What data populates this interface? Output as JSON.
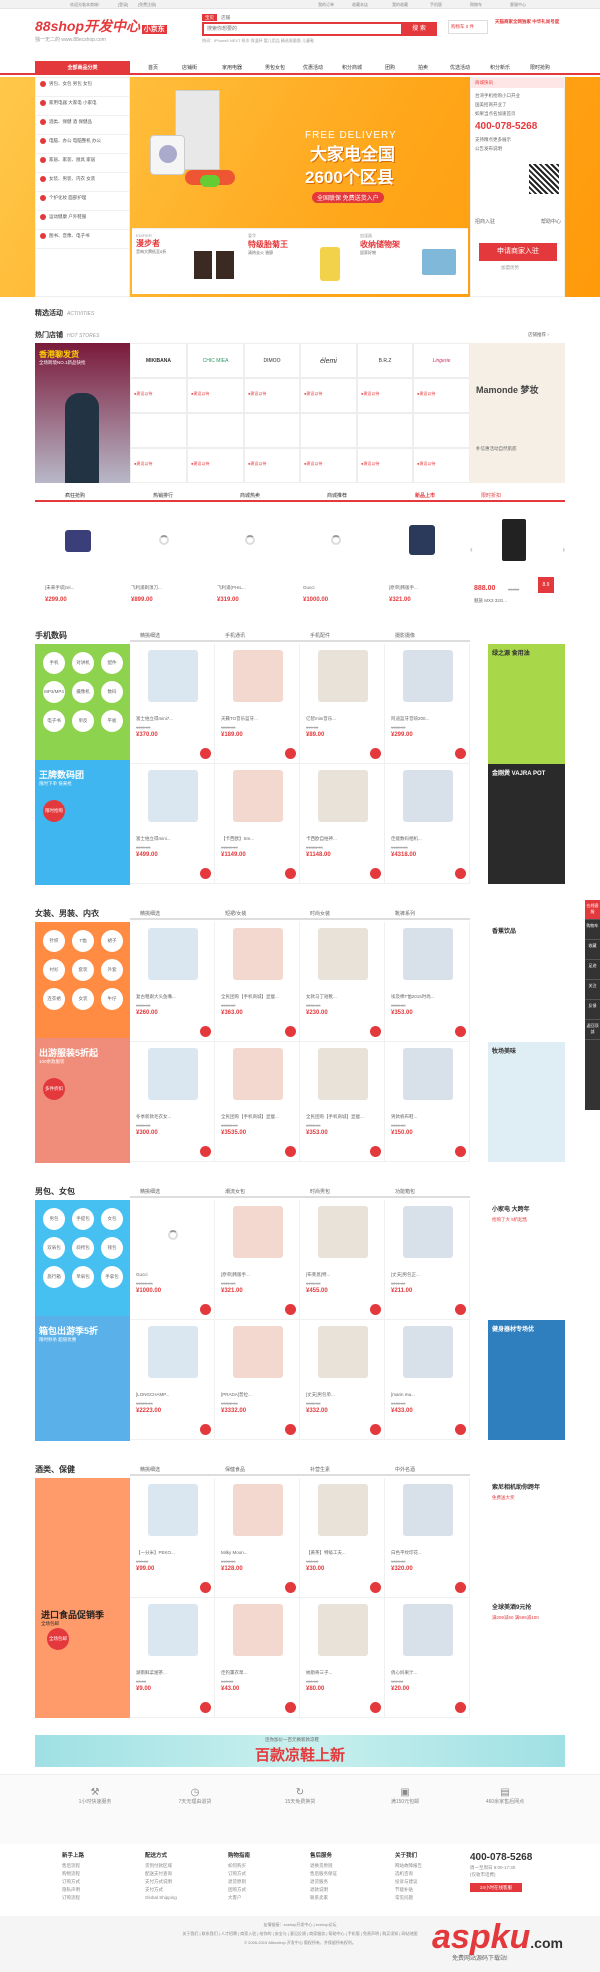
{
  "topbar": {
    "left": [
      "欢迎光临本商城！",
      "[登录]",
      "[免费注册]"
    ],
    "right": [
      "我的订单",
      "收藏本店",
      "我的收藏",
      "手机版",
      "购物车",
      "客服中心"
    ]
  },
  "header": {
    "logo": "88shop开发中心",
    "logo_badge": "小京东",
    "logo_url": "独一无二的 www.88ecshop.com",
    "search_tab": "宝贝",
    "search_tab2": "店铺",
    "search_placeholder": "搜索你想要的",
    "search_button": "搜 索",
    "hot_words": "热词：iPhone6  NEXT  纸巾  保温杯  婴儿用品  精选限量版  儿童鞋",
    "cart_label": "购物车 0 件",
    "right_promo": "天猫商家全网独家 中华礼尚号度"
  },
  "nav": {
    "all_categories": "全部商品分类",
    "items": [
      "首页",
      "店铺街",
      "家用电器",
      "男包女包",
      "优惠活动",
      "积分商城",
      "团购",
      "拍卖",
      "优选活动",
      "积分新乐",
      "限时抢购"
    ]
  },
  "side_menu": [
    "男包、女包 男包 女包",
    "家用电器 大家电 小家电",
    "酒类、保健 酒 保健品",
    "电脑、办公 电脑整机 办公",
    "家居、家装、厨具 家居",
    "女装、男装、内衣 女装",
    "个护化妆 面部护理",
    "运动健康 户外鞋服",
    "图书、音像、电子书"
  ],
  "banner": {
    "free_delivery": "FREE DELIVERY",
    "title1": "大家电全国",
    "title2": "2600个区县",
    "sub": "全国联保 免费送货入户"
  },
  "sub_banners": [
    {
      "brand": "EDIFIER",
      "title": "漫步者",
      "desc": "音响大牌低至5折"
    },
    {
      "brand": "爱华",
      "title": "特级胎菊王",
      "desc": "清热去火 香醇"
    },
    {
      "brand": "加湿器",
      "title": "收纳储物架",
      "desc": "居家好物"
    }
  ],
  "right_panel": {
    "header": "商城快讯",
    "news": [
      "台湾手机抢购小口开业",
      "国美招商开业了",
      "如果当点名加速首页",
      "支持精点更多展示",
      "公告发布说明"
    ],
    "phone": "400-078-5268",
    "tab1": "招商入驻",
    "tab2": "帮助中心",
    "apply": "申请商家入驻",
    "apply_sub": "加盟优势"
  },
  "activities": {
    "title": "精选活动",
    "sub": "ACTIVITIES"
  },
  "hot_shops": {
    "title": "热门店铺",
    "sub": "HOT STORES",
    "more": "店铺推荐 ›",
    "promo_title": "香港聊发货",
    "promo_sub": "全场跨境NO.1新品快抢",
    "brands": [
      "MIKIBANA",
      "CHIC MIEA",
      "DIMOO",
      "élemi",
      "B.R.Z",
      "Lingerie"
    ],
    "shop_label": "●建设以待",
    "right_ad": "Mamonde 梦妆",
    "right_ad_sub": "朴信惠活动自然肌底"
  },
  "recommend_tabs": [
    "疯狂抢购",
    "热销排行",
    "商城热卖",
    "商城推荐",
    "新品上市",
    "限时折扣"
  ],
  "recommend_items": [
    {
      "name": "[未来手袋]rel...",
      "price": "¥299.00"
    },
    {
      "name": "飞利浦剃须刀...",
      "price": "¥899.00"
    },
    {
      "name": "飞利浦(PHIL...",
      "price": "¥319.00"
    },
    {
      "name": "Gucci",
      "price": "¥1000.00"
    },
    {
      "name": "[原单]韩版手...",
      "price": "¥321.00"
    }
  ],
  "flash": {
    "price": "888.00",
    "old": "¥1000",
    "name": "魅族 MX3 32G...",
    "badge": "8.9"
  },
  "floors": [
    {
      "title": "手机数码",
      "tabs": [
        "精挑细选",
        "手机通讯",
        "手机配件",
        "摄影摄像"
      ],
      "circles": [
        "手机",
        "对讲机",
        "配件",
        "MP3/MP4",
        "摄像机",
        "数码",
        "电子书",
        "单反",
        "平板",
        "数码相机"
      ],
      "promo": "王牌数码团",
      "promo_sub": "限时下单 快来抢",
      "badge": "限时抢购",
      "items": [
        {
          "name": "富士拍立得mini7...",
          "old": "¥450.00",
          "price": "¥370.00"
        },
        {
          "name": "天籁TO音乐蓝牙...",
          "old": "¥220.00",
          "price": "¥189.00"
        },
        {
          "name": "亿智mini音乐...",
          "old": "¥99.00",
          "price": "¥89.00"
        },
        {
          "name": "阿迪蓝牙音响200...",
          "old": "¥350.00",
          "price": "¥299.00"
        },
        {
          "name": "富士拍立得mini...",
          "old": "¥599.00",
          "price": "¥499.00"
        },
        {
          "name": "【卡西欧】Sm...",
          "old": "¥1249.00",
          "price": "¥1149.00"
        },
        {
          "name": "卡西欧自拍神...",
          "old": "¥1888.00",
          "price": "¥1148.00"
        },
        {
          "name": "佳能数码相机...",
          "old": "¥4699.00",
          "price": "¥4318.00"
        }
      ],
      "right_ad1": "绿之源 食用油",
      "right_ad2": "金刚煲 VAJRA POT"
    },
    {
      "title": "女装、男装、内衣",
      "tabs": [
        "精挑细选",
        "短裙/女装",
        "时尚女装",
        "靴裤系列"
      ],
      "circles": [
        "针织",
        "T恤",
        "裙子",
        "衬衫",
        "套装",
        "外套",
        "连衣裙",
        "女装",
        "牛仔",
        "内衣"
      ],
      "promo": "出游服装5折起",
      "promo_sub": "100余款服装",
      "badge": "多件折扣",
      "items": [
        {
          "name": "复古粗跟大头鱼嘴...",
          "old": "¥300.00",
          "price": "¥260.00"
        },
        {
          "name": "全民团购【手机商城】显瘦...",
          "old": "¥363.00",
          "price": "¥363.00"
        },
        {
          "name": "女款马丁短靴...",
          "old": "¥230.00",
          "price": "¥230.00"
        },
        {
          "name": "埃及棉T恤2015时尚...",
          "old": "¥353.00",
          "price": "¥353.00"
        },
        {
          "name": "冬季新款毛衣女...",
          "old": "¥350.00",
          "price": "¥300.00"
        },
        {
          "name": "全民团购【手机商城】显瘦...",
          "old": "¥3535.00",
          "price": "¥3535.00"
        },
        {
          "name": "全民团购【手机商城】显瘦...",
          "old": "¥353.00",
          "price": "¥353.00"
        },
        {
          "name": "男款帆布鞋...",
          "old": "¥150.00",
          "price": "¥150.00"
        }
      ],
      "right_ad1": "香蕉饮品",
      "right_ad2": "牧场美味"
    },
    {
      "title": "男包、女包",
      "tabs": [
        "精挑细选",
        "潮流女包",
        "时尚男包",
        "功能箱包"
      ],
      "circles": [
        "男包",
        "手提包",
        "女包",
        "双肩包",
        "斜挎包",
        "钱包",
        "旅行箱",
        "单肩包",
        "手拿包",
        "卡包"
      ],
      "promo": "箱包出游季5折",
      "promo_sub": "限时秒杀 超值优惠",
      "items": [
        {
          "name": "Gucci",
          "old": "¥1000.00",
          "price": "¥1000.00"
        },
        {
          "name": "[原单]韩版手...",
          "old": "¥321.00",
          "price": "¥321.00"
        },
        {
          "name": "[布莱恩]特...",
          "old": "¥455.00",
          "price": "¥455.00"
        },
        {
          "name": "[丈夫]男包正...",
          "old": "¥211.00",
          "price": "¥211.00"
        },
        {
          "name": "[LONGCHAMP...",
          "old": "¥2223.00",
          "price": "¥2223.00"
        },
        {
          "name": "[PRADA]普拉...",
          "old": "¥3332.00",
          "price": "¥3332.00"
        },
        {
          "name": "[丈夫]男包单...",
          "old": "¥332.00",
          "price": "¥332.00"
        },
        {
          "name": "[marin ma...",
          "old": "¥433.00",
          "price": "¥433.00"
        }
      ],
      "right_ad1": "小家电 大跨年",
      "right_ad1_sub": "抢购了大 5折起售",
      "right_ad2": "健身器材专场优"
    },
    {
      "title": "酒类、保健",
      "tabs": [
        "精挑细选",
        "保健食品",
        "补营生素",
        "中外名酒"
      ],
      "promo": "进口食品促销季",
      "promo_sub": "全场包邮",
      "badge": "全场包邮",
      "items": [
        {
          "name": "【一分米】PEKO...",
          "old": "¥99.00",
          "price": "¥99.00"
        },
        {
          "name": "Milky Moon...",
          "old": "¥128.00",
          "price": "¥128.00"
        },
        {
          "name": "【黄茶】特级工夫...",
          "old": "¥30.00",
          "price": "¥30.00"
        },
        {
          "name": "白色平纹印花...",
          "old": "¥320.00",
          "price": "¥320.00"
        },
        {
          "name": "湖南鲜菜湘茶...",
          "old": "¥9.00",
          "price": "¥9.00"
        },
        {
          "name": "佳钓薰衣草...",
          "old": "¥43.00",
          "price": "¥43.00"
        },
        {
          "name": "纳斯奇三子...",
          "old": "¥80.00",
          "price": "¥80.00"
        },
        {
          "name": "俏心妈果汁...",
          "old": "¥20.00",
          "price": "¥20.00"
        }
      ],
      "right_ad1": "索尼相机助你跨年",
      "right_ad1_sub": "免费送大奖",
      "right_ad2": "全球美酒9元抢",
      "right_ad2_sub": "满299减50 满599减100"
    }
  ],
  "bottom_banner": {
    "title": "百款凉鞋上新",
    "sub": "连你加价一百元换新款凉鞋"
  },
  "services": [
    "1小时快速服务",
    "7天无理由退货",
    "15天免费换货",
    "满150元包邮",
    "460余家售后网点"
  ],
  "footer_cols": [
    {
      "title": "新手上路",
      "links": [
        "售后流程",
        "购物流程",
        "订购方式",
        "隐私声明",
        "订购流程"
      ]
    },
    {
      "title": "配送方式",
      "links": [
        "货到付款区域",
        "配送支付查询",
        "支付方式说明",
        "支付方式",
        "Global Shipping"
      ]
    },
    {
      "title": "购物指南",
      "links": [
        "如何购买",
        "订购方式",
        "退货原则",
        "团购方式",
        "大客户"
      ]
    },
    {
      "title": "售后服务",
      "links": [
        "退换货原则",
        "售后服务保证",
        "退货服务",
        "退款说明",
        "联系卖家"
      ]
    },
    {
      "title": "关于我们",
      "links": [
        "网站故障报告",
        "选机咨询",
        "投诉与建议",
        "节能补贴",
        "常见问题"
      ]
    }
  ],
  "footer_contact": {
    "phone": "400-078-5268",
    "hours": "周一至周日 9:00-17:30",
    "note": "(仅收市话费)",
    "btn": "24小时在线客服"
  },
  "footer_bottom": {
    "links": "关于我们 | 联系我们 | 人才招聘 | 商家入驻 | 给你的 | 安全与 | 意见反馈 | 商家服务 | 帮助中心 | 手机版 | 免责声明 | 购买须知 | 网站地图",
    "links2": "友情链接：ecshop开发中心 | ecshop论坛",
    "copyright": "© 2005-2015 88ecshop 开发中心 版权所有，并保留所有权利。"
  },
  "side_dock": [
    "在线客服",
    "购物车",
    "收藏",
    "足迹",
    "关注",
    "反馈",
    "返回顶部"
  ],
  "watermark": {
    "text": "aspku",
    "suffix": ".com",
    "sub": "免费网站源码下载站!"
  },
  "colors": {
    "accent": "#e4393c",
    "banner": "#ffb21e",
    "dark": "#333333"
  }
}
